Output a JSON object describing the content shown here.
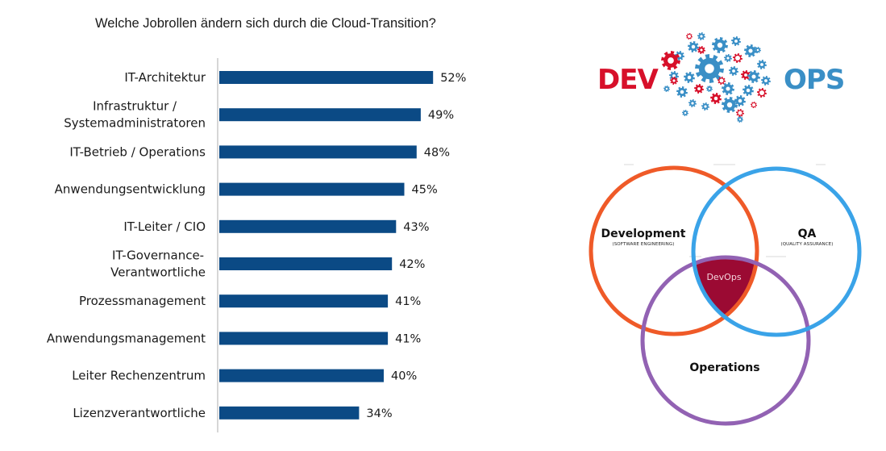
{
  "chart_data": {
    "type": "bar",
    "orientation": "horizontal",
    "title": "Welche Jobrollen ändern sich durch die Cloud-Transition?",
    "xlabel": "",
    "ylabel": "",
    "categories": [
      [
        "IT-Architektur"
      ],
      [
        "Infrastruktur /",
        "Systemadministratoren"
      ],
      [
        "IT-Betrieb / Operations"
      ],
      [
        "Anwendungsentwicklung"
      ],
      [
        "IT-Leiter / CIO"
      ],
      [
        "IT-Governance-",
        "Verantwortliche"
      ],
      [
        "Prozessmanagement"
      ],
      [
        "Anwendungsmanagement"
      ],
      [
        "Leiter Rechenzentrum"
      ],
      [
        "Lizenzverantwortliche"
      ]
    ],
    "values": [
      52,
      49,
      48,
      45,
      43,
      42,
      41,
      41,
      40,
      34
    ],
    "value_labels": [
      "52%",
      "49%",
      "48%",
      "45%",
      "43%",
      "42%",
      "41%",
      "41%",
      "40%",
      "34%"
    ],
    "unit": "%",
    "xlim": [
      0,
      100
    ],
    "grid": false,
    "legend": "none",
    "bar_color": "#0b4a85",
    "axis_color": "#d6d6d6"
  },
  "logo": {
    "left_word": "DEV",
    "right_word": "OPS",
    "left_color": "#d7102a",
    "right_color": "#3a8fc6",
    "gear_colors": [
      "#3a8fc6",
      "#d7102a"
    ],
    "icon": "brain-of-gears-icon"
  },
  "venn": {
    "sets": [
      {
        "id": "development",
        "title": "Development",
        "subtitle": "(SOFTWARE ENGINEERING)",
        "color": "#ef5a28"
      },
      {
        "id": "qa",
        "title": "QA",
        "subtitle": "(QUALITY ASSURANCE)",
        "color": "#3aa3e8"
      },
      {
        "id": "operations",
        "title": "Operations",
        "subtitle": "",
        "color": "#9262b3"
      }
    ],
    "intersection": {
      "label": "DevOps",
      "color": "#9b0a33"
    }
  }
}
